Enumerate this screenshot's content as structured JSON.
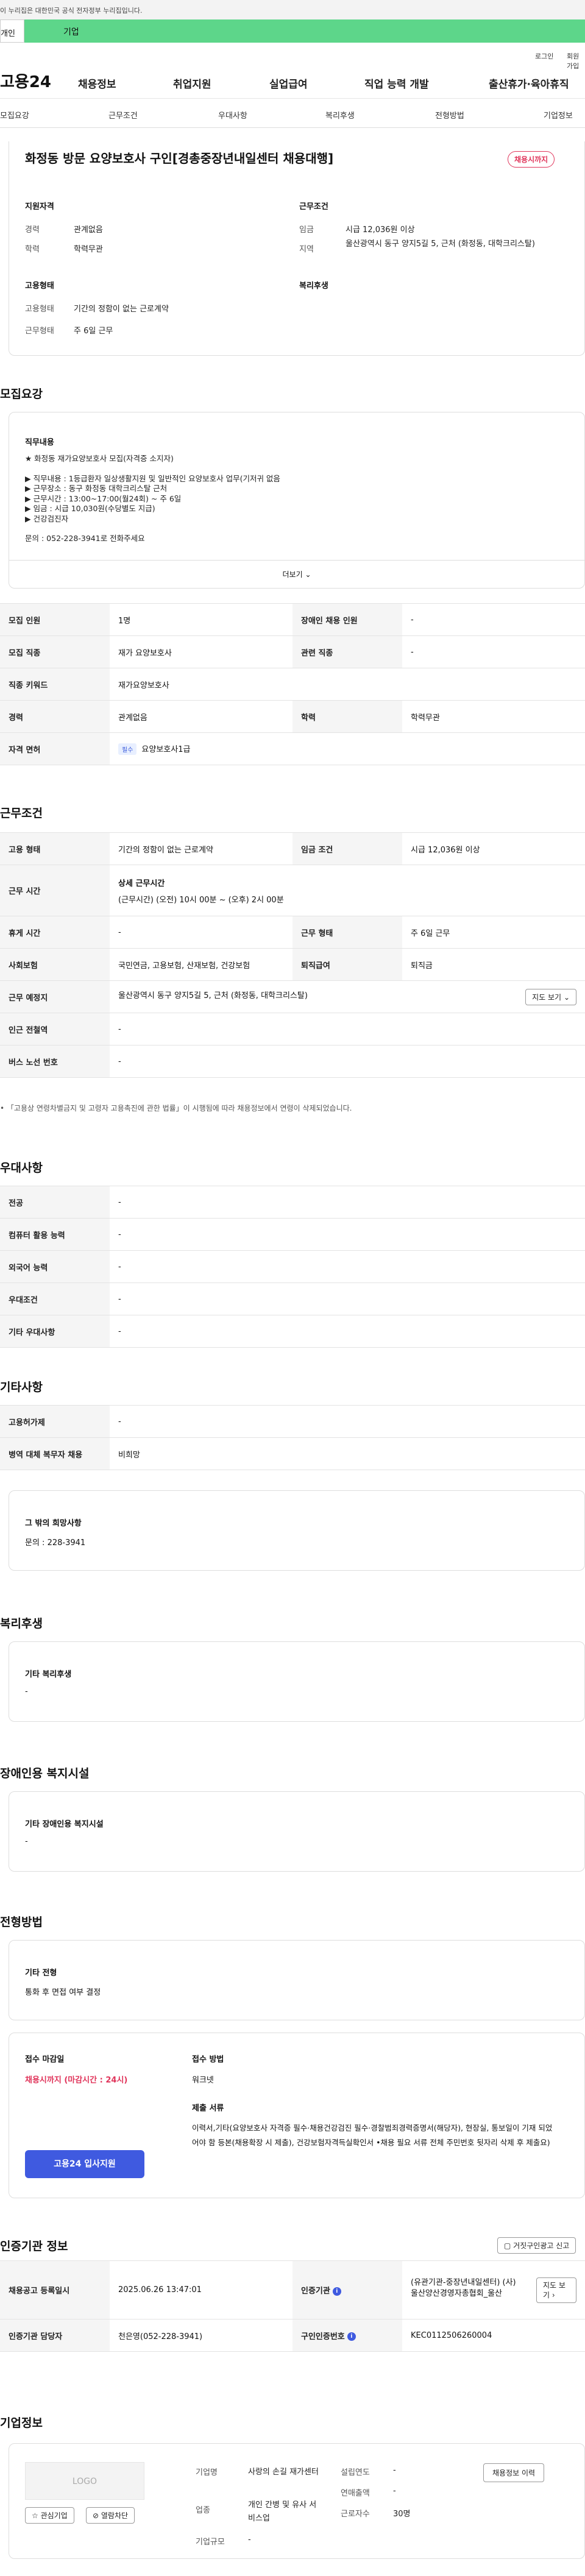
{
  "gov_banner": "이 누리집은 대한민국 공식 전자정부 누리집입니다.",
  "segments": {
    "personal": "개인",
    "company": "기업"
  },
  "util": {
    "login": "로그인",
    "signup": "회원가입"
  },
  "logo": "고용24",
  "nav": [
    "채용정보",
    "취업지원",
    "실업급여",
    "직업 능력 개발",
    "출산휴가·육아휴직"
  ],
  "subnav": [
    "모집요강",
    "근무조건",
    "우대사항",
    "복리후생",
    "전형방법",
    "기업정보"
  ],
  "job": {
    "title": "화정동 방문 요양보호사 구인[경총중장년내일센터 채용대행]",
    "status_badge": "채용시까지",
    "qual_heading": "지원자격",
    "career_label": "경력",
    "career_value": "관계없음",
    "edu_label": "학력",
    "edu_value": "학력무관",
    "cond_heading": "근무조건",
    "wage_label": "임금",
    "wage_value": "시급 12,036원 이상",
    "area_label": "지역",
    "area_value": "울산광역시 동구 양지5길 5, 근처 (화정동, 대학크리스탈)",
    "emp_heading": "고용형태",
    "emp_value": "기간의 정함이 없는 근로계약",
    "worktype_label": "근무형태",
    "worktype_value": "주 6일 근무",
    "welfare_heading": "복리후생"
  },
  "recruit": {
    "heading": "모집요강",
    "desc_heading": "직무내용",
    "desc_lines": [
      "★ 화정동 재가요양보호사 모집(자격증 소지자)",
      "",
      "▶ 직무내용 : 1등급환자 일상생활지원 및 일반적인 요양보호사 업무(기저귀 없음",
      "▶ 근무장소 : 동구 화정동 대학크리스탈 근처",
      "▶ 근무시간 : 13:00~17:00(월24회) ~ 주 6일",
      "▶ 임금 : 시급 10,030원(수당별도 지급)",
      "▶ 건강검진자",
      "",
      "문의 : 052-228-3941로 전화주세요"
    ],
    "more_label": "더보기",
    "rows": [
      {
        "l1": "모집 인원",
        "v1": "1명",
        "l2": "장애인 채용 인원",
        "v2": "-"
      },
      {
        "l1": "모집 직종",
        "v1": "재가 요양보호사",
        "l2": "관련 직종",
        "v2": "-"
      },
      {
        "l1": "직종 키워드",
        "v1": "재가요양보호사"
      },
      {
        "l1": "경력",
        "v1": "관계없음",
        "l2": "학력",
        "v2": "학력무관"
      },
      {
        "l1": "자격 면허",
        "tag": "필수",
        "v1": "요양보호사1급"
      }
    ]
  },
  "conditions": {
    "heading": "근무조건",
    "rows": [
      {
        "l1": "고용 형태",
        "v1": "기간의 정함이 없는 근로계약",
        "l2": "임금 조건",
        "v2": "시급 12,036원 이상"
      },
      {
        "l1": "근무 시간",
        "v1": "상세 근무시간",
        "v1b": "(근무시간) (오전) 10시 00분 ~ (오후) 2시 00분"
      },
      {
        "l1": "휴게 시간",
        "v1": "-",
        "l2": "근무 형태",
        "v2": "주 6일 근무"
      },
      {
        "l1": "사회보험",
        "v1": "국민연금, 고용보험, 산재보험, 건강보험",
        "l2": "퇴직급여",
        "v2": "퇴직금"
      },
      {
        "l1": "근무 예정지",
        "v1": "울산광역시 동구 양지5길 5, 근처 (화정동, 대학크리스탈)",
        "btn": "지도 보기"
      },
      {
        "l1": "인근 전철역",
        "v1": "-"
      },
      {
        "l1": "버스 노선 번호",
        "v1": "-"
      }
    ],
    "note": "「고용상 연령차별금지 및 고령자 고용촉진에 관한 법률」이 시행됨에 따라 채용정보에서 연령이 삭제되었습니다."
  },
  "prefs": {
    "heading": "우대사항",
    "rows": [
      {
        "l": "전공",
        "v": "-"
      },
      {
        "l": "컴퓨터 활용 능력",
        "v": "-"
      },
      {
        "l": "외국어 능력",
        "v": "-"
      },
      {
        "l": "우대조건",
        "v": "-"
      },
      {
        "l": "기타 우대사항",
        "v": "-"
      }
    ]
  },
  "etc": {
    "heading": "기타사항",
    "rows": [
      {
        "l": "고용허가제",
        "v": "-"
      },
      {
        "l": "병역 대체 복무자 채용",
        "v": "비희망"
      }
    ],
    "box_title": "그 밖의 희망사항",
    "box_value": "문의 : 228-3941"
  },
  "welfare": {
    "heading": "복리후생",
    "box_title": "기타 복리후생",
    "box_value": "-"
  },
  "disability": {
    "heading": "장애인용 복지시설",
    "box_title": "기타 장애인용 복지시설",
    "box_value": "-"
  },
  "selection": {
    "heading": "전형방법",
    "box_title": "기타 전형",
    "box_value": "통화 후 면접 여부 결정",
    "deadline_label": "접수 마감일",
    "deadline_value": "채용시까지 (마감시간 : 24시)",
    "apply_btn": "고용24 입사지원",
    "method_label": "접수 방법",
    "method_value": "워크넷",
    "docs_label": "제출 서류",
    "docs_value": "이력서,기타(요양보호사 자격증 필수·채용건강검진 필수·경찰범죄경력증명서(해당자), 현장실, 통보일이 기재 되었어야 함 등본(채용확장 시 제출), 건강보험자격득실확인서 •채용 필요 서류 전체 주민번호 뒷자리 삭제 후 제출요)"
  },
  "cert": {
    "heading": "인증기관 정보",
    "report_btn": "거짓구인광고 신고",
    "rows": [
      {
        "l1": "채용공고 등록일시",
        "v1": "2025.06.26 13:47:01",
        "l2": "인증기관",
        "v2": "(유관기관-중장년내일센터) (사)울산양산경영자총협회_울산",
        "btn": "지도 보기"
      },
      {
        "l1": "인증기관 담당자",
        "v1": "천은영(052-228-3941)",
        "l2": "구인인증번호",
        "v2": "KEC0112506260004"
      }
    ]
  },
  "company": {
    "heading": "기업정보",
    "logo_text": "LOGO",
    "fav_btn": "관심기업",
    "block_btn": "열람차단",
    "name_label": "기업명",
    "name_value": "사랑의 손길 재가센터",
    "year_label": "설립연도",
    "year_value": "-",
    "sales_label": "연매출액",
    "sales_value": "-",
    "industry_label": "업종",
    "industry_value": "개인 간병 및 유사 서비스업",
    "staff_label": "근로자수",
    "staff_value": "30명",
    "size_label": "기업규모",
    "size_value": "-",
    "info_btn": "채용정보 이력"
  }
}
